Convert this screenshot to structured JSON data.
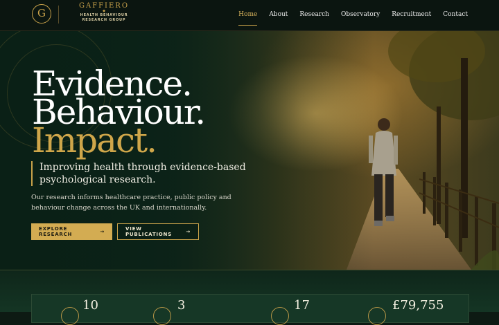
{
  "brand": {
    "logo_letter": "G",
    "name": "GAFFIERO",
    "separator": "◆",
    "subtitle_line1": "HEALTH BEHAVIOUR",
    "subtitle_line2": "RESEARCH GROUP"
  },
  "nav": {
    "items": [
      {
        "label": "Home",
        "active": true
      },
      {
        "label": "About",
        "active": false
      },
      {
        "label": "Research",
        "active": false
      },
      {
        "label": "Observatory",
        "active": false
      },
      {
        "label": "Recruitment",
        "active": false
      },
      {
        "label": "Contact",
        "active": false
      }
    ]
  },
  "hero": {
    "headline_1": "Evidence.",
    "headline_2": "Behaviour.",
    "headline_3": "Impact.",
    "tagline": "Improving health through evidence-based psychological research.",
    "description": "Our research informs healthcare practice, public policy and behaviour change across the UK and internationally.",
    "primary_button": "EXPLORE RESEARCH",
    "secondary_button": "VIEW PUBLICATIONS",
    "arrow": "→"
  },
  "stats": {
    "values": [
      "10",
      "3",
      "17",
      "£79,755"
    ]
  },
  "colors": {
    "accent": "#c9a24a",
    "background": "#0d1a13"
  }
}
